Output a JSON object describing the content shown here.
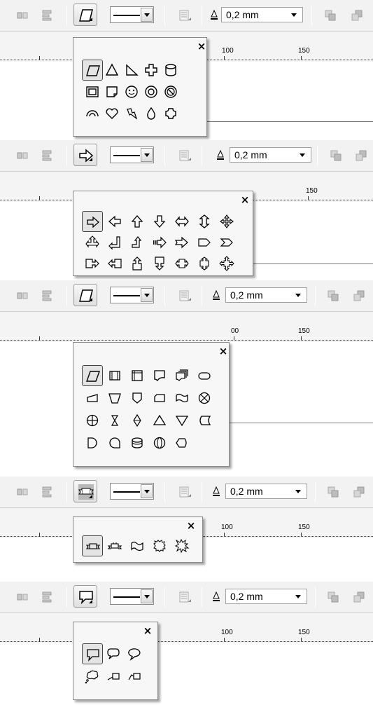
{
  "toolbar": {
    "outline_width": "0,2 mm",
    "icons": [
      "align-icon",
      "distribute-icon",
      "shape-tool-icon",
      "line-style-icon",
      "outline-pen-icon",
      "to-front-icon",
      "to-back-icon"
    ]
  },
  "panels": [
    {
      "tool_icon": "parallelogram-icon",
      "ruler_labels": [
        "100",
        "150"
      ],
      "close_label": "×",
      "shapes": [
        [
          "parallelogram-icon",
          "triangle-icon",
          "right-triangle-icon",
          "cross-icon",
          "cylinder-icon"
        ],
        [
          "frame-icon",
          "folded-corner-icon",
          "smiley-icon",
          "donut-icon",
          "no-symbol-icon"
        ],
        [
          "arc-icon",
          "heart-icon",
          "lightning-icon",
          "drop-icon",
          "plaque-icon"
        ]
      ]
    },
    {
      "tool_icon": "right-arrow-icon",
      "ruler_labels": [
        "150"
      ],
      "close_label": "×",
      "shapes": [
        [
          "right-arrow-icon",
          "left-arrow-icon",
          "up-arrow-icon",
          "down-arrow-icon",
          "left-right-arrow-icon",
          "up-down-arrow-icon",
          "quad-arrow-icon"
        ],
        [
          "left-right-up-arrow-icon",
          "bent-left-arrow-icon",
          "bent-up-arrow-icon",
          "striped-right-arrow-icon",
          "notched-right-arrow-icon",
          "pentagon-arrow-icon",
          "chevron-arrow-icon"
        ],
        [
          "right-arrow-callout-icon",
          "left-arrow-callout-icon",
          "up-arrow-callout-icon",
          "down-arrow-callout-icon",
          "left-right-arrow-callout-icon",
          "up-down-arrow-callout-icon",
          "quad-arrow-callout-icon"
        ]
      ]
    },
    {
      "tool_icon": "flowchart-process-icon",
      "ruler_labels": [
        "00",
        "150"
      ],
      "close_label": "×",
      "shapes": [
        [
          "flowchart-data-icon",
          "flowchart-predefined-process-icon",
          "flowchart-internal-storage-icon",
          "flowchart-document-icon",
          "flowchart-multidocument-icon",
          "flowchart-terminator-icon"
        ],
        [
          "flowchart-manual-input-icon",
          "flowchart-manual-operation-icon",
          "flowchart-off-page-connector-icon",
          "flowchart-card-icon",
          "flowchart-punched-tape-icon",
          "flowchart-summing-junction-icon"
        ],
        [
          "flowchart-or-icon",
          "flowchart-collate-icon",
          "flowchart-sort-icon",
          "flowchart-extract-icon",
          "flowchart-merge-icon",
          "flowchart-stored-data-icon"
        ],
        [
          "flowchart-delay-icon",
          "flowchart-sequential-access-icon",
          "flowchart-magnetic-disk-icon",
          "flowchart-direct-access-icon",
          "flowchart-display-icon"
        ]
      ]
    },
    {
      "tool_icon": "banner-icon",
      "ruler_labels": [
        "100",
        "150"
      ],
      "close_label": "×",
      "shapes": [
        [
          "ribbon-banner-icon",
          "up-ribbon-banner-icon",
          "wave-banner-icon",
          "explosion-icon",
          "explosion-2-icon"
        ]
      ]
    },
    {
      "tool_icon": "callout-icon",
      "ruler_labels": [
        "100",
        "150"
      ],
      "close_label": "×",
      "shapes": [
        [
          "rectangular-callout-icon",
          "rounded-callout-icon",
          "oval-callout-icon"
        ],
        [
          "cloud-callout-icon",
          "line-callout-icon",
          "line-callout-2-icon"
        ]
      ]
    }
  ]
}
